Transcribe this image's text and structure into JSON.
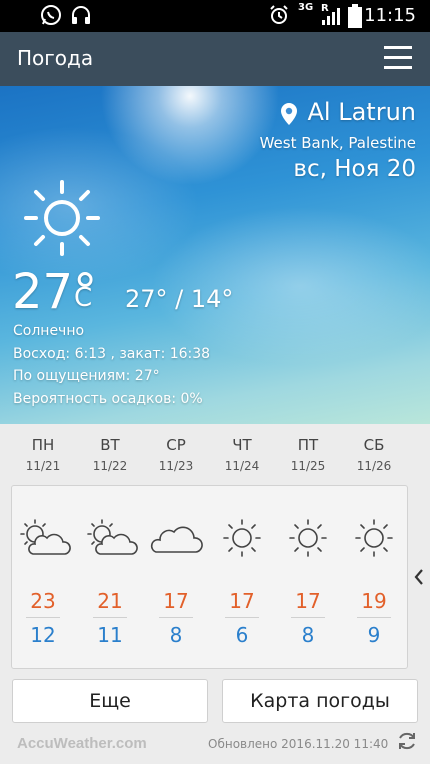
{
  "status": {
    "time": "11:15",
    "network": "3G",
    "roaming": "R",
    "icons": [
      "whatsapp-icon",
      "headphones-icon",
      "alarm-icon",
      "signal-icon",
      "battery-icon"
    ]
  },
  "app": {
    "title": "Погода",
    "menu_icon": "hamburger-menu-icon"
  },
  "current": {
    "location": "Al Latrun",
    "region": "West Bank, Palestine",
    "date": "вс, Ноя 20",
    "temp": "27°",
    "unit": "C",
    "range": "27° / 14°",
    "condition": "Солнечно",
    "sunrise_sunset": "Восход: 6:13 , закат: 16:38",
    "feels_like": "По ощущениям: 27°",
    "precipitation": "Вероятность осадков: 0%",
    "icon": "sunny-icon"
  },
  "forecast": [
    {
      "day": "ПН",
      "date": "11/21",
      "icon": "partly-cloudy-icon",
      "high": "23",
      "low": "12"
    },
    {
      "day": "ВТ",
      "date": "11/22",
      "icon": "partly-cloudy-icon",
      "high": "21",
      "low": "11"
    },
    {
      "day": "СР",
      "date": "11/23",
      "icon": "cloudy-icon",
      "high": "17",
      "low": "8"
    },
    {
      "day": "ЧТ",
      "date": "11/24",
      "icon": "sunny-icon",
      "high": "17",
      "low": "6"
    },
    {
      "day": "ПТ",
      "date": "11/25",
      "icon": "sunny-icon",
      "high": "17",
      "low": "8"
    },
    {
      "day": "СБ",
      "date": "11/26",
      "icon": "sunny-icon",
      "high": "19",
      "low": "9"
    }
  ],
  "buttons": {
    "more": "Еще",
    "map": "Карта погоды"
  },
  "footer": {
    "logo": "AccuWeather.com",
    "updated": "Обновлено 2016.11.20 11:40"
  },
  "colors": {
    "app_bar": "#3b4d5c",
    "high_temp": "#e2602a",
    "low_temp": "#2a7fcc"
  }
}
